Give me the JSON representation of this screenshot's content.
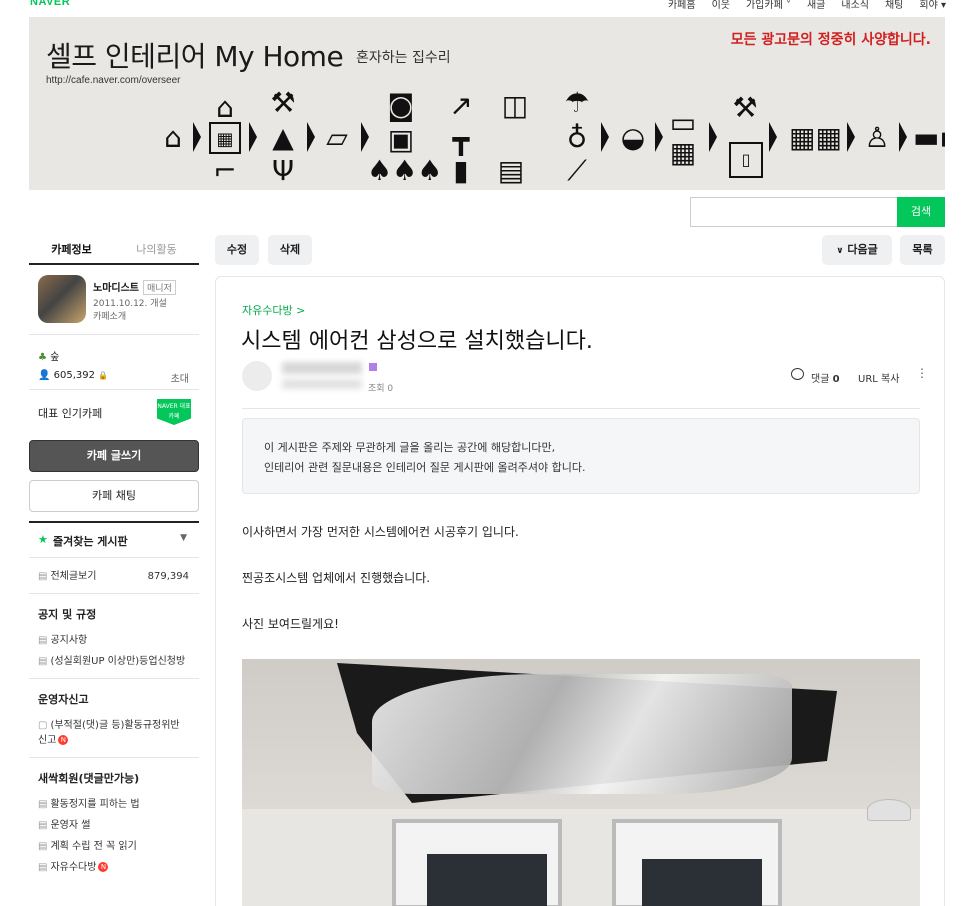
{
  "gnb": {
    "logo": "NAVER",
    "links": [
      "카페홈",
      "이웃",
      "가입카페 ˅",
      "새글",
      "내소식",
      "채팅",
      "회야 ▾"
    ]
  },
  "banner": {
    "title": "셀프 인테리어 My Home",
    "subtitle": "혼자하는 집수리",
    "url": "http://cafe.naver.com/overseer",
    "ad_notice": "모든 광고문의 정중히 사양합니다."
  },
  "search": {
    "placeholder": "",
    "button": "검색"
  },
  "sidebar": {
    "tabs": [
      "카페정보",
      "나의활동"
    ],
    "manager_name": "노마디스트",
    "manager_badge": "매니저",
    "since": "2011.10.12. 개설",
    "intro_link": "카페소개",
    "grade": "숲",
    "member_count": "605,392",
    "invite": "초대",
    "popular_label": "대표 인기카페",
    "popular_badge": "NAVER 대표카페",
    "write_button": "카페 글쓰기",
    "chat_button": "카페 채팅",
    "favorites_label": "즐겨찾는 게시판",
    "all_posts_label": "전체글보기",
    "all_posts_count": "879,394",
    "groups": [
      {
        "title": "공지 및 규정",
        "items": [
          "공지사항",
          "(성실회원UP 이상만)등업신청방"
        ]
      },
      {
        "title": "운영자신고",
        "items": [
          "(부적절(댓)글 등)활동규정위반 신고"
        ]
      },
      {
        "title": "새싹회원(댓글만가능)",
        "items": [
          "활동정지를 피하는 법",
          "운영자 썰",
          "계획 수립 전 꼭 읽기",
          "자유수다방"
        ]
      }
    ]
  },
  "toolbar": {
    "edit": "수정",
    "delete": "삭제",
    "next": "다음글",
    "list": "목록"
  },
  "article": {
    "board": "자유수다방 >",
    "title": "시스템 에어컨 삼성으로 설치했습니다.",
    "views": "조회 0",
    "comments_label": "댓글",
    "comments_count": "0",
    "url_copy": "URL 복사",
    "notice_line1": "이 게시판은 주제와 무관하게 글을 올리는 공간에 해당합니다만,",
    "notice_line2": "인테리어 관련 질문내용은 인테리어 질문 게시판에 올려주셔야 합니다.",
    "body": [
      "이사하면서 가장 먼저한 시스템에어컨 시공후기 입니다.",
      "찐공조시스템 업체에서 진행했습니다.",
      "사진 보여드릴게요!"
    ]
  },
  "colors": {
    "accent": "#03c75a",
    "ad_notice": "#d12020"
  }
}
